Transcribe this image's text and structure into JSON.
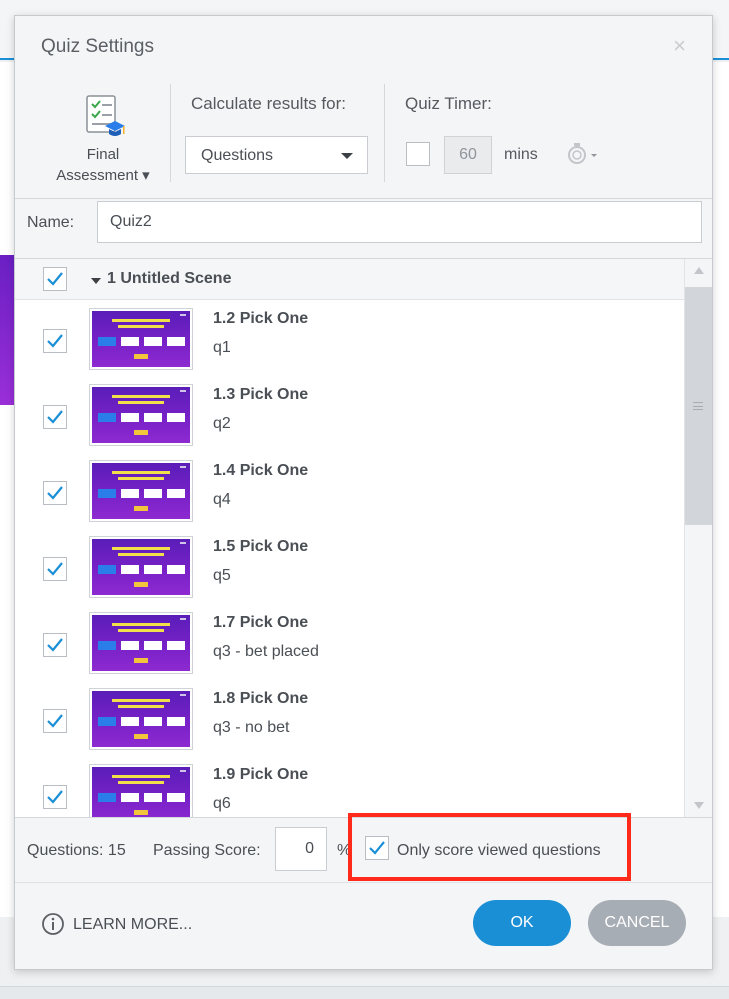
{
  "dialog": {
    "title": "Quiz Settings",
    "close_glyph": "×"
  },
  "toolbar": {
    "assessment_label_line1": "Final",
    "assessment_label_line2": "Assessment ▾",
    "calculate_label": "Calculate results for:",
    "calculate_value": "Questions",
    "timer_label": "Quiz Timer:",
    "timer_value": "60",
    "timer_unit": "mins"
  },
  "name": {
    "label": "Name:",
    "value": "Quiz2"
  },
  "scene": {
    "title": "1 Untitled Scene",
    "checked": true
  },
  "questions": [
    {
      "title": "1.2 Pick One",
      "subtitle": "q1"
    },
    {
      "title": "1.3 Pick One",
      "subtitle": "q2"
    },
    {
      "title": "1.4 Pick One",
      "subtitle": "q4"
    },
    {
      "title": "1.5 Pick One",
      "subtitle": "q5"
    },
    {
      "title": "1.7 Pick One",
      "subtitle": "q3 - bet placed"
    },
    {
      "title": "1.8 Pick One",
      "subtitle": "q3 - no bet"
    },
    {
      "title": "1.9 Pick One",
      "subtitle": "q6"
    }
  ],
  "footer": {
    "questions_count": "Questions: 15",
    "passing_label": "Passing Score:",
    "passing_value": "0",
    "percent": "%",
    "only_viewed_label": "Only score viewed questions",
    "learn_more": "LEARN MORE...",
    "ok": "OK",
    "cancel": "CANCEL"
  },
  "colors": {
    "accent": "#1a8fd6",
    "check": "#1a8fd6",
    "highlight": "#ff2a1a",
    "cancel": "#a7adb4"
  },
  "icons": {
    "assessment": "quiz-document-icon",
    "timer": "stopwatch-icon",
    "info": "info-icon",
    "close": "close-icon"
  }
}
